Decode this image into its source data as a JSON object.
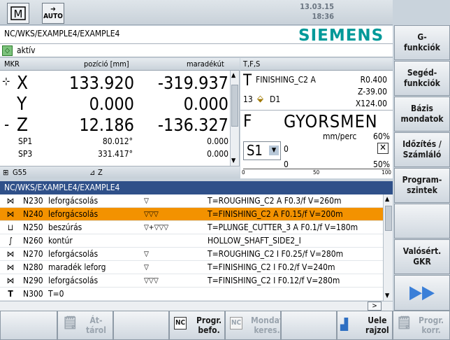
{
  "header": {
    "mode_icon": "machine-mode-icon",
    "mode_auto_label": "AUTO",
    "date": "13.03.15",
    "time": "18:36",
    "program_path": "NC/WKS/EXAMPLE4/EXAMPLE4",
    "brand": "SIEMENS",
    "status_label": "aktív"
  },
  "mkr": {
    "title": "MKR",
    "col_position": "pozíció [mm]",
    "col_remaining": "maradékút",
    "axes": [
      {
        "name": "X",
        "position": "133.920",
        "remaining": "-319.937"
      },
      {
        "name": "Y",
        "position": "0.000",
        "remaining": "0.000"
      },
      {
        "name": "Z",
        "position": "12.186",
        "remaining": "-136.327"
      }
    ],
    "spindles": [
      {
        "name": "SP1",
        "position": "80.012°",
        "remaining": "0.000"
      },
      {
        "name": "SP3",
        "position": "331.417°",
        "remaining": "0.000"
      }
    ],
    "work_offset": "G55",
    "plane": "Z"
  },
  "tfs": {
    "title": "T,F,S",
    "tool_letter": "T",
    "tool_name": "FINISHING_C2 A",
    "tool_r": "R0.400",
    "tool_z": "Z-39.00",
    "tool_x": "X124.00",
    "tool_num": "13",
    "tool_d": "D1",
    "feed_letter": "F",
    "feed_value": "GYORSMEN",
    "feed_unit": "mm/perc",
    "feed_percent": "60%",
    "spindle_name": "S1",
    "spindle_val1": "0",
    "spindle_val2": "0",
    "spindle_percent": "50%",
    "scale_0": "0",
    "scale_50": "50",
    "scale_100": "100"
  },
  "program": {
    "title": "NC/WKS/EXAMPLE4/EXAMPLE4",
    "rows": [
      {
        "n": "N230",
        "op": "leforgácsolás",
        "tri": "▽",
        "tool": "T=ROUGHING_C2 A F0.3/f V=260m",
        "sel": false
      },
      {
        "n": "N240",
        "op": "leforgácsolás",
        "tri": "▽▽▽",
        "tool": "T=FINISHING_C2 A F0.15/f V=200m",
        "sel": true
      },
      {
        "n": "N250",
        "op": "beszúrás",
        "tri": "▽+▽▽▽",
        "tool": "T=PLUNGE_CUTTER_3 A F0.1/f V=180m",
        "sel": false
      },
      {
        "n": "N260",
        "op": "kontúr",
        "tri": "",
        "tool": "HOLLOW_SHAFT_SIDE2_I",
        "sel": false
      },
      {
        "n": "N270",
        "op": "leforgácsolás",
        "tri": "▽",
        "tool": "T=ROUGHING_C2 I F0.25/f V=280m",
        "sel": false
      },
      {
        "n": "N280",
        "op": "maradék leforg",
        "tri": "▽",
        "tool": "T=FINISHING_C2 I F0.2/f V=240m",
        "sel": false
      },
      {
        "n": "N290",
        "op": "leforgácsolás",
        "tri": "▽▽▽",
        "tool": "T=FINISHING_C2 I F0.12/f V=280m",
        "sel": false
      },
      {
        "n": "N300",
        "op": "T=0",
        "tri": "",
        "tool": "",
        "sel": false
      }
    ]
  },
  "softkeys_v": [
    "G-\nfunkciók",
    "Segéd-\nfunkciók",
    "Bázis\nmondatok",
    "Időzítés /\nSzámláló",
    "Program-\nszintek",
    "",
    "Valósért.\nGKR",
    ""
  ],
  "softkeys_h": {
    "atarol": "Át-\ntárol",
    "progr_befo": "Progr.\nbefo.",
    "mondat_keres": "Mondat\nkeres.",
    "uele_rajzol": "Uele\nrajzol",
    "progr_korr": "Progr.\nkorr."
  }
}
